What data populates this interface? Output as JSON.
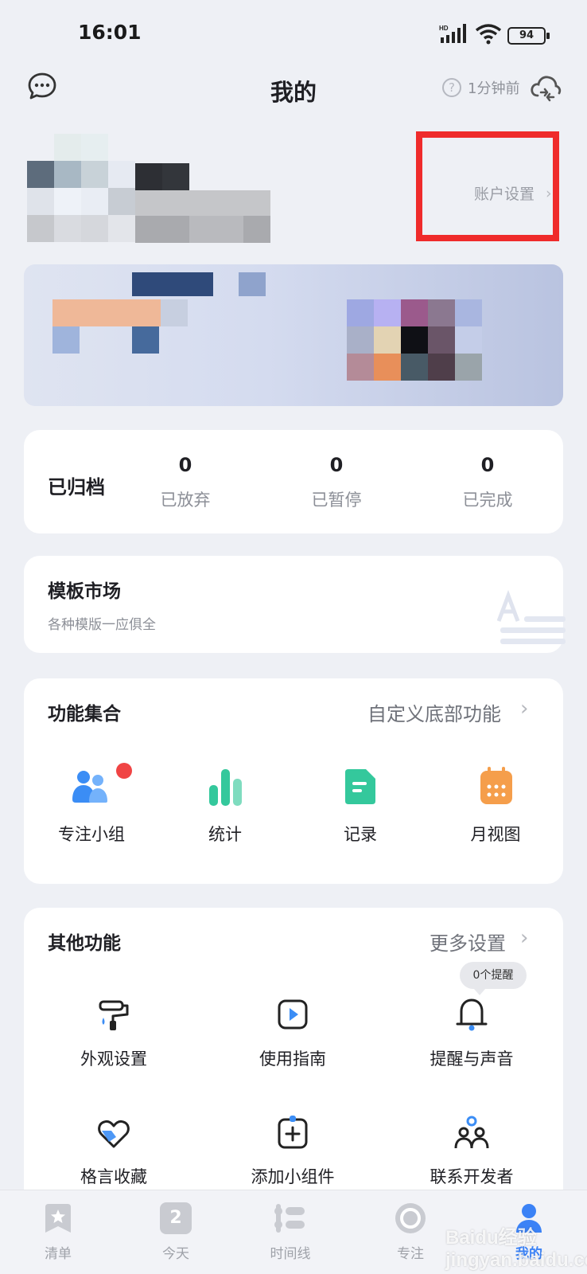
{
  "status_bar": {
    "time": "16:01",
    "network": "HD",
    "battery": "94"
  },
  "header": {
    "title": "我的",
    "help": "?",
    "sync_status": "1分钟前"
  },
  "profile": {
    "account_settings": "账户设置",
    "chevron": "›"
  },
  "archive": {
    "title": "已归档",
    "stats": [
      {
        "value": "0",
        "label": "已放弃"
      },
      {
        "value": "0",
        "label": "已暂停"
      },
      {
        "value": "0",
        "label": "已完成"
      }
    ]
  },
  "template_market": {
    "title": "模板市场",
    "subtitle": "各种模版一应俱全"
  },
  "functions": {
    "title": "功能集合",
    "link": "自定义底部功能",
    "items": [
      {
        "label": "专注小组",
        "icon": "group-icon",
        "color": "#3b8df5",
        "badge": true
      },
      {
        "label": "统计",
        "icon": "stats-icon",
        "color": "#34c89c"
      },
      {
        "label": "记录",
        "icon": "record-icon",
        "color": "#34c89c"
      },
      {
        "label": "月视图",
        "icon": "calendar-icon",
        "color": "#f59e4b"
      }
    ]
  },
  "other": {
    "title": "其他功能",
    "link": "更多设置",
    "reminder_tip": "0个提醒",
    "items": [
      {
        "label": "外观设置",
        "icon": "paint-roller-icon"
      },
      {
        "label": "使用指南",
        "icon": "guide-play-icon"
      },
      {
        "label": "提醒与声音",
        "icon": "bell-icon"
      },
      {
        "label": "格言收藏",
        "icon": "heart-icon"
      },
      {
        "label": "添加小组件",
        "icon": "add-widget-icon"
      },
      {
        "label": "联系开发者",
        "icon": "contact-developer-icon"
      }
    ]
  },
  "tabbar": {
    "tabs": [
      {
        "label": "清单",
        "icon": "list-icon"
      },
      {
        "label": "今天",
        "icon": "today-icon",
        "day": "2"
      },
      {
        "label": "时间线",
        "icon": "timeline-icon"
      },
      {
        "label": "专注",
        "icon": "focus-icon"
      },
      {
        "label": "我的",
        "icon": "profile-icon",
        "active": true
      }
    ]
  },
  "watermark": "Baidu经验 jingyan.baidu.com",
  "colors": {
    "accent": "#3b82f6",
    "highlight_box": "#ef2b2b",
    "badge": "#f04444"
  }
}
